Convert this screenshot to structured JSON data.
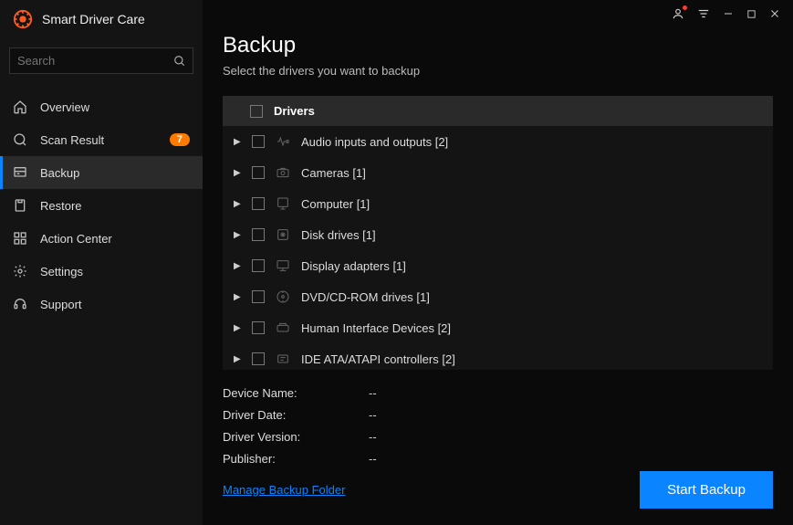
{
  "app": {
    "title": "Smart Driver Care"
  },
  "search": {
    "placeholder": "Search"
  },
  "nav": {
    "items": [
      {
        "label": "Overview"
      },
      {
        "label": "Scan Result",
        "badge": "7"
      },
      {
        "label": "Backup"
      },
      {
        "label": "Restore"
      },
      {
        "label": "Action Center"
      },
      {
        "label": "Settings"
      },
      {
        "label": "Support"
      }
    ]
  },
  "page": {
    "title": "Backup",
    "subtitle": "Select the drivers you want to backup",
    "header_label": "Drivers"
  },
  "drivers": [
    {
      "label": "Audio inputs and outputs  [2]"
    },
    {
      "label": "Cameras  [1]"
    },
    {
      "label": "Computer  [1]"
    },
    {
      "label": "Disk drives  [1]"
    },
    {
      "label": "Display adapters  [1]"
    },
    {
      "label": "DVD/CD-ROM drives  [1]"
    },
    {
      "label": "Human Interface Devices  [2]"
    },
    {
      "label": "IDE ATA/ATAPI controllers  [2]"
    }
  ],
  "details": {
    "device_name_label": "Device Name:",
    "device_name_value": "--",
    "driver_date_label": "Driver Date:",
    "driver_date_value": "--",
    "driver_version_label": "Driver Version:",
    "driver_version_value": "--",
    "publisher_label": "Publisher:",
    "publisher_value": "--"
  },
  "actions": {
    "manage_link": "Manage Backup Folder",
    "start_backup": "Start Backup"
  },
  "colors": {
    "accent": "#0a84ff",
    "badge": "#ff7a00"
  }
}
